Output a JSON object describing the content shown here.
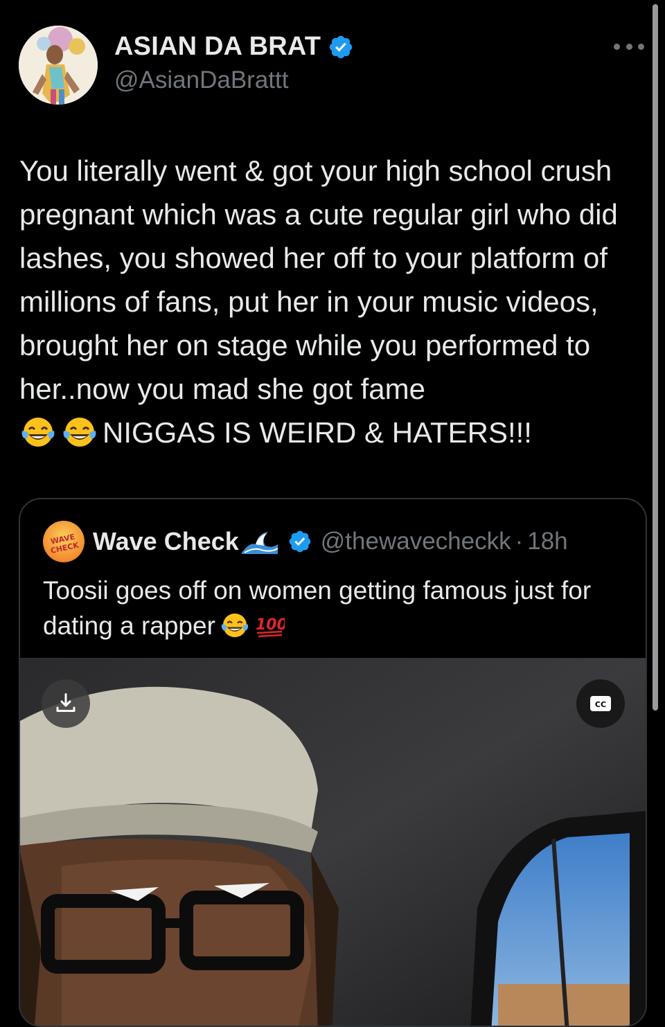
{
  "author": {
    "display_name": "ASIAN DA BRAT",
    "handle": "@AsianDaBrattt",
    "verified_icon": "verified-badge-icon",
    "avatar_icon": "profile-avatar"
  },
  "menu": {
    "icon": "more-options-icon"
  },
  "tweet": {
    "text": "You literally went & got your high school crush pregnant which was a cute regular girl who did lashes, you showed her off to your platform of millions of fans, put her in your music videos, brought her on stage while you performed to her..now you mad she got fame",
    "emojis": [
      "face-with-tears-of-joy",
      "face-with-tears-of-joy"
    ],
    "text_end": "NIGGAS IS WEIRD & HATERS!!!"
  },
  "quoted_tweet": {
    "avatar_text": "WAVE CHECK",
    "display_name": "Wave Check",
    "name_emoji": "water-wave",
    "handle": "@thewavecheckk",
    "separator": "·",
    "time": "18h",
    "text": "Toosii goes off on women getting famous just for dating a rapper",
    "emojis": [
      "face-with-tears-of-joy",
      "hundred-points"
    ],
    "media": {
      "download_icon": "download-icon",
      "captions_icon": "cc-icon",
      "captions_label": "CC"
    }
  },
  "colors": {
    "background": "#000000",
    "text": "#e7e9ea",
    "secondary": "#71767b",
    "verified": "#1d9bf0",
    "border": "#2f3336"
  }
}
